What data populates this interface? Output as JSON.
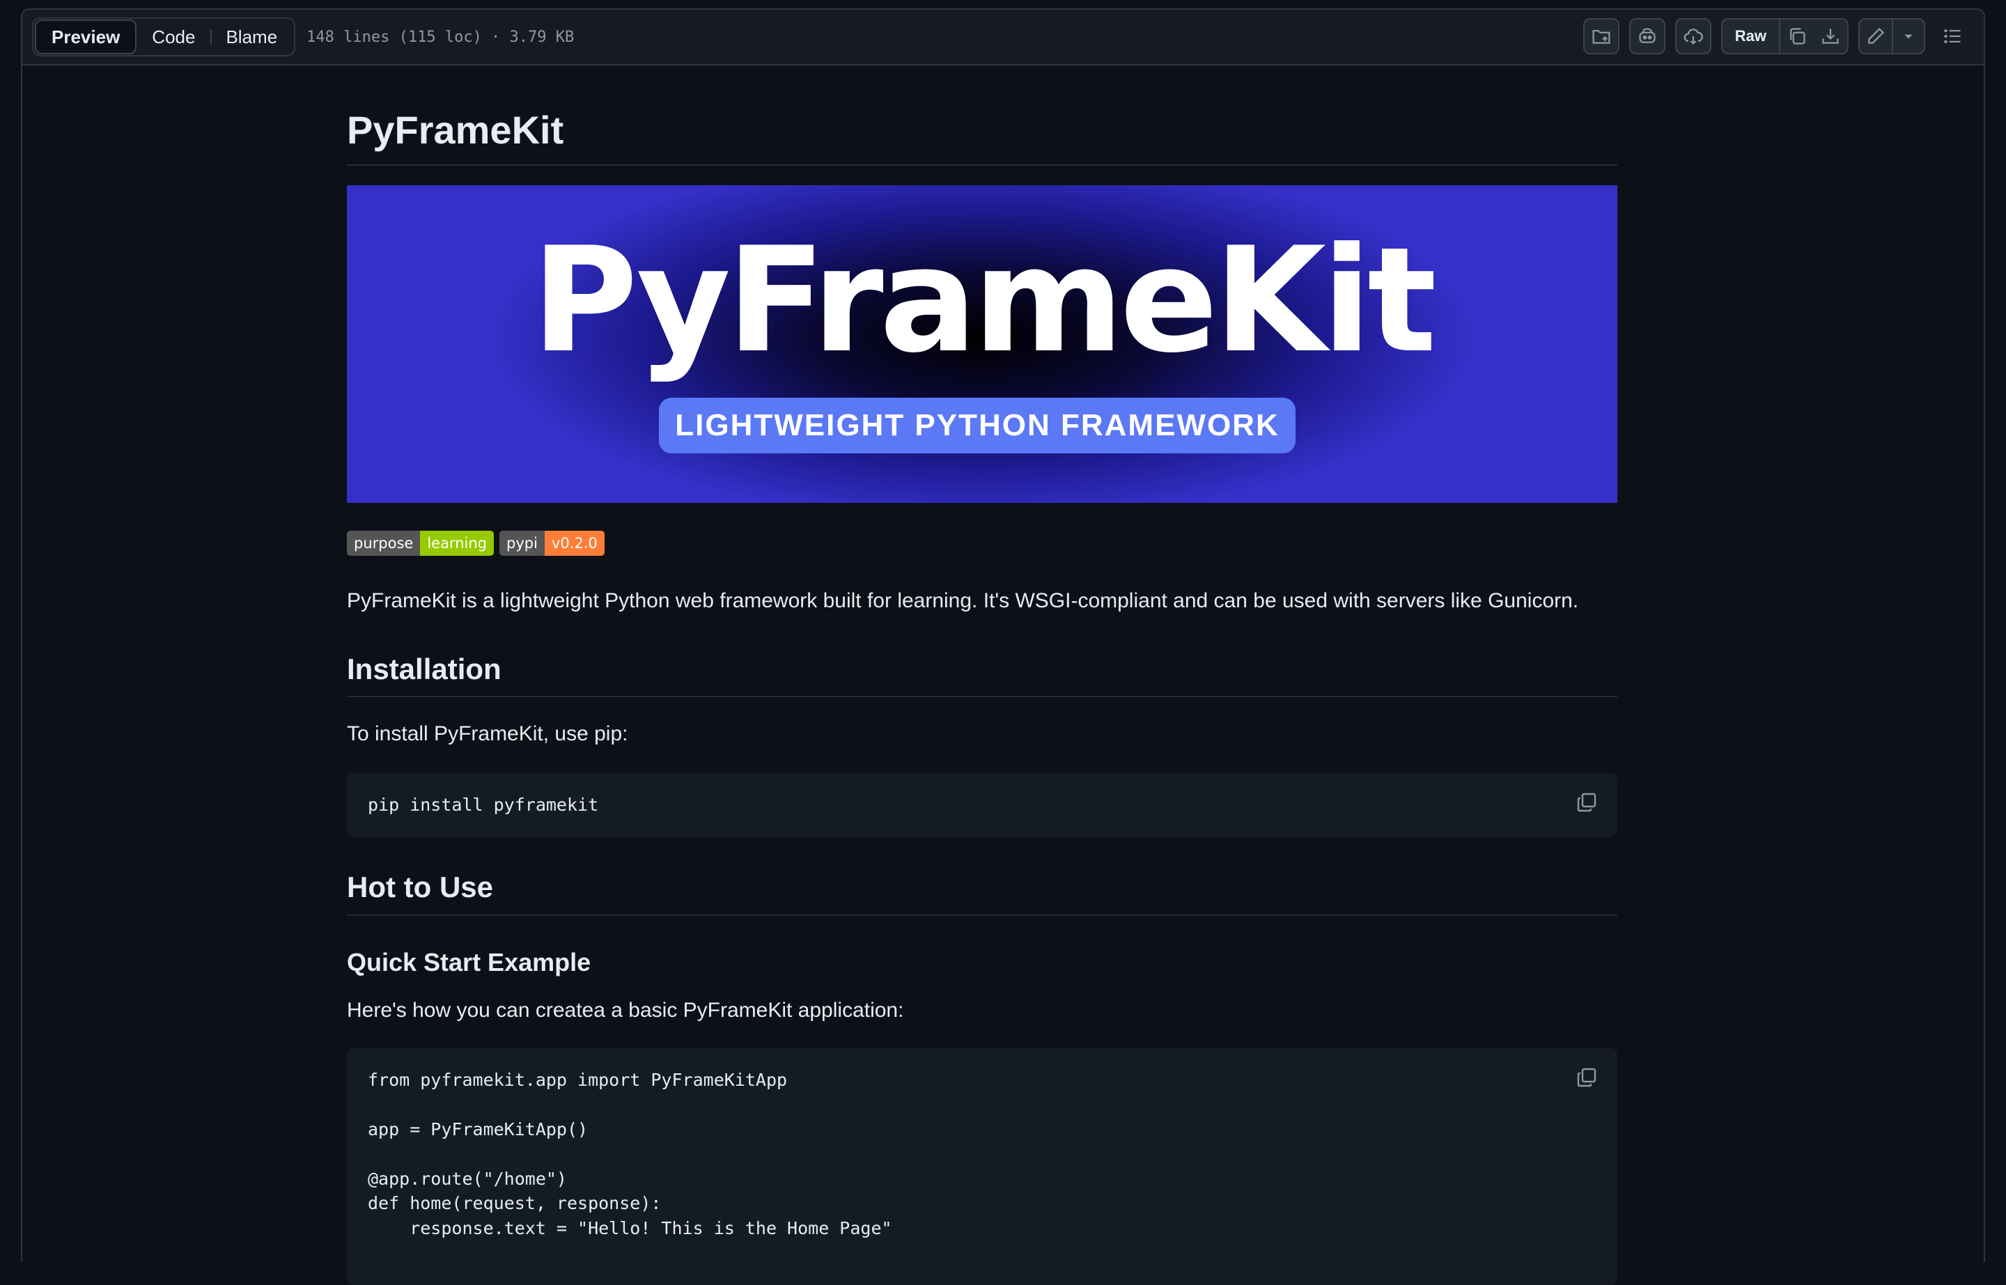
{
  "toolbar": {
    "tabs": [
      {
        "label": "Preview",
        "active": true
      },
      {
        "label": "Code",
        "active": false
      },
      {
        "label": "Blame",
        "active": false
      }
    ],
    "file_meta": "148 lines (115 loc) · 3.79 KB",
    "raw_label": "Raw",
    "icons": [
      "add-file-icon",
      "copilot-icon",
      "codespaces-icon",
      "copy-raw-icon",
      "download-icon",
      "edit-pencil-icon",
      "caret-down-icon",
      "outline-list-icon"
    ]
  },
  "readme": {
    "title": "PyFrameKit",
    "banner": {
      "title": "PyFrameKit",
      "subtitle": "LIGHTWEIGHT PYTHON FRAMEWORK"
    },
    "badges": [
      {
        "label": "purpose",
        "value": "learning",
        "color": "#97ca00"
      },
      {
        "label": "pypi",
        "value": "v0.2.0",
        "color": "#fe7d37"
      }
    ],
    "intro": "PyFrameKit is a lightweight Python web framework built for learning. It's WSGI-compliant and can be used with servers like Gunicorn.",
    "installation": {
      "heading": "Installation",
      "text": "To install PyFrameKit, use pip:",
      "code": "pip install pyframekit"
    },
    "usage": {
      "heading": "Hot to Use",
      "subheading": "Quick Start Example",
      "text": "Here's how you can createa a basic PyFrameKit application:",
      "code": "from pyframekit.app import PyFrameKitApp\n\napp = PyFrameKitApp()\n\n@app.route(\"/home\")\ndef home(request, response):\n    response.text = \"Hello! This is the Home Page\""
    }
  },
  "colors": {
    "background": "#0d1117",
    "toolbar": "#161b22",
    "border": "#30363d",
    "code_bg": "#151b23",
    "banner_blue": "#3430c8",
    "pill_blue": "#5b78f5"
  }
}
